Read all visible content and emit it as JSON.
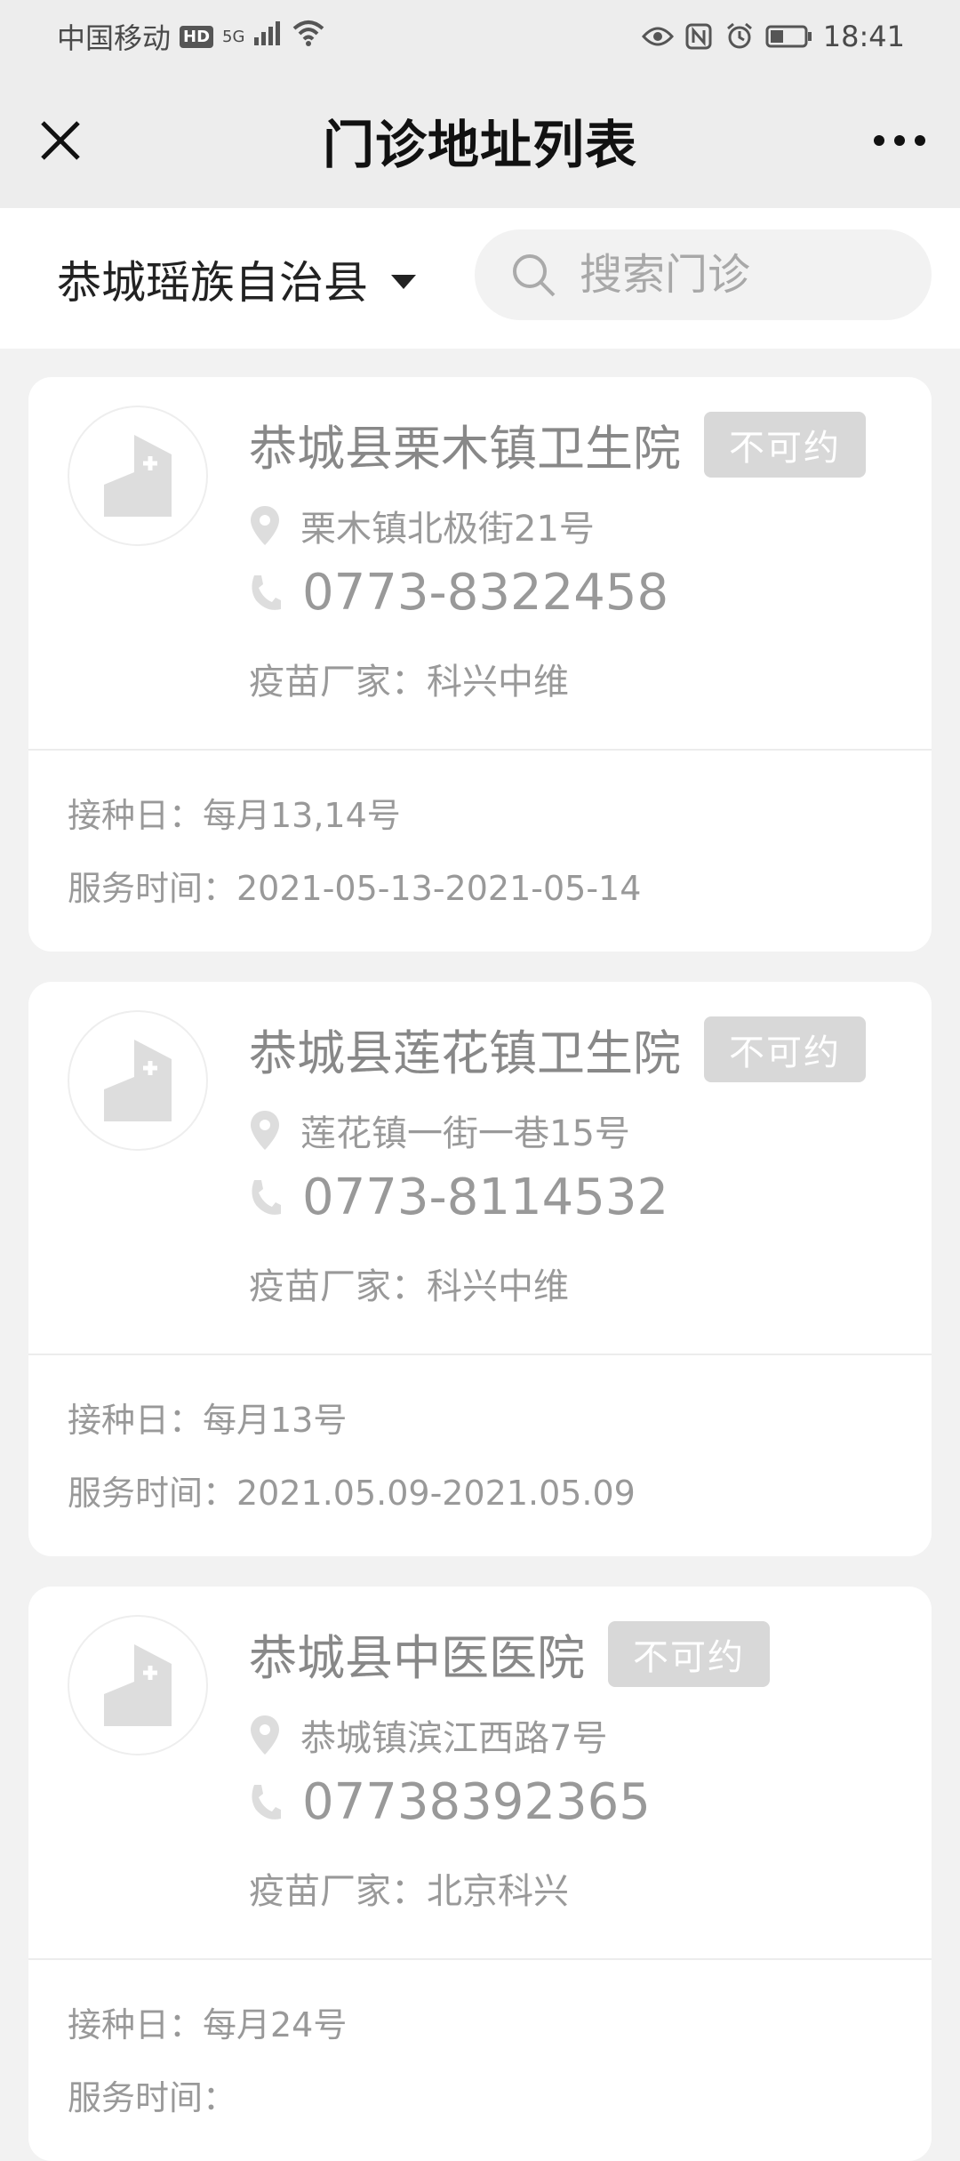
{
  "status": {
    "carrier": "中国移动",
    "hd": "HD",
    "network": "5G",
    "time": "18:41"
  },
  "nav": {
    "title": "门诊地址列表"
  },
  "filter": {
    "region": "恭城瑶族自治县",
    "search_placeholder": "搜索门诊"
  },
  "clinics": [
    {
      "name": "恭城县栗木镇卫生院",
      "badge": "不可约",
      "address": "栗木镇北极街21号",
      "phone": "0773-8322458",
      "vendor": "疫苗厂家：科兴中维",
      "days": "接种日：每月13,14号",
      "hours": "服务时间：2021-05-13-2021-05-14"
    },
    {
      "name": "恭城县莲花镇卫生院",
      "badge": "不可约",
      "address": "莲花镇一街一巷15号",
      "phone": "0773-8114532",
      "vendor": "疫苗厂家：科兴中维",
      "days": "接种日：每月13号",
      "hours": "服务时间：2021.05.09-2021.05.09"
    },
    {
      "name": "恭城县中医医院",
      "badge": "不可约",
      "address": "恭城镇滨江西路7号",
      "phone": "07738392365",
      "vendor": "疫苗厂家：北京科兴",
      "days": "接种日：每月24号",
      "hours": "服务时间："
    }
  ],
  "icons": {
    "close": "close-icon",
    "more": "more-dots-icon",
    "search": "search-icon",
    "location": "location-pin-icon",
    "phone": "phone-icon",
    "clinic_logo": "clinic-building-icon"
  },
  "colors": {
    "nav_bg": "#ededed",
    "badge_bg": "#d8d8d8",
    "muted_text": "#999999"
  }
}
